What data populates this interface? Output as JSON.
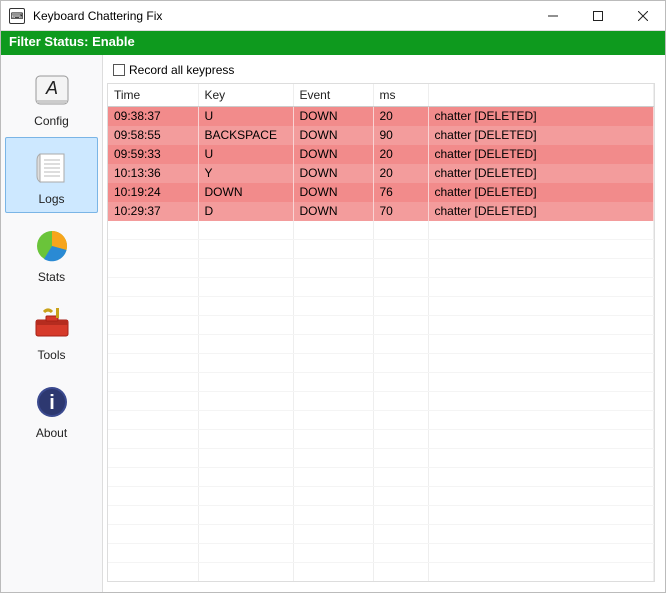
{
  "window": {
    "title": "Keyboard Chattering Fix"
  },
  "status": {
    "text": "Filter Status: Enable"
  },
  "sidebar": {
    "items": [
      {
        "label": "Config"
      },
      {
        "label": "Logs"
      },
      {
        "label": "Stats"
      },
      {
        "label": "Tools"
      },
      {
        "label": "About"
      }
    ]
  },
  "checkbox": {
    "label": "Record all keypress",
    "checked": false
  },
  "table": {
    "headers": [
      "Time",
      "Key",
      "Event",
      "ms",
      ""
    ],
    "rows": [
      {
        "time": "09:38:37",
        "key": "U",
        "event": "DOWN",
        "ms": "20",
        "note": "chatter [DELETED]"
      },
      {
        "time": "09:58:55",
        "key": "BACKSPACE",
        "event": "DOWN",
        "ms": "90",
        "note": "chatter [DELETED]"
      },
      {
        "time": "09:59:33",
        "key": "U",
        "event": "DOWN",
        "ms": "20",
        "note": "chatter [DELETED]"
      },
      {
        "time": "10:13:36",
        "key": "Y",
        "event": "DOWN",
        "ms": "20",
        "note": "chatter [DELETED]"
      },
      {
        "time": "10:19:24",
        "key": "DOWN",
        "event": "DOWN",
        "ms": "76",
        "note": "chatter [DELETED]"
      },
      {
        "time": "10:29:37",
        "key": "D",
        "event": "DOWN",
        "ms": "70",
        "note": "chatter [DELETED]"
      }
    ]
  }
}
